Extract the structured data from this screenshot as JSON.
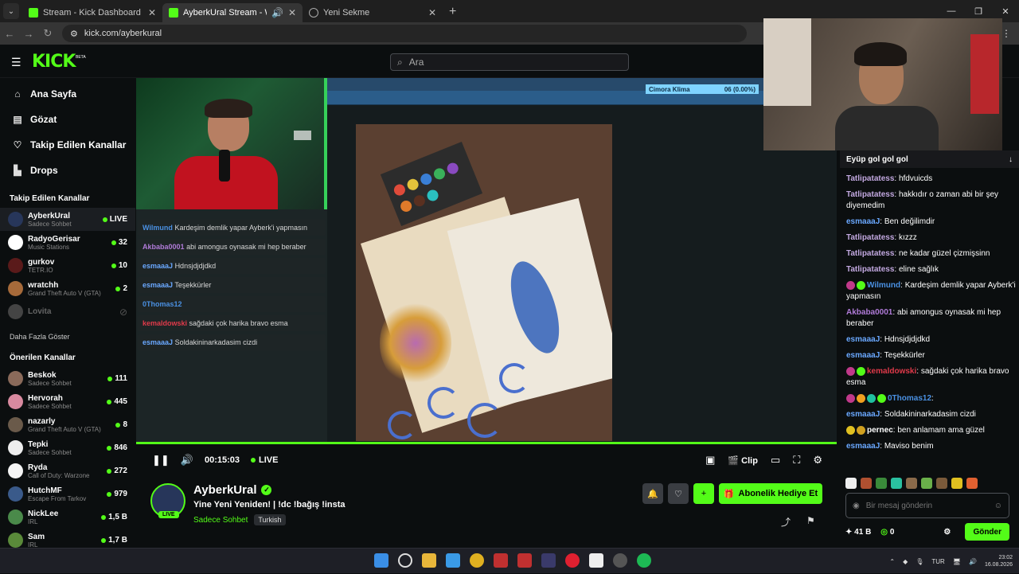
{
  "browser": {
    "tabs": [
      {
        "title": "Stream - Kick Dashboard",
        "active": false
      },
      {
        "title": "AyberkUral Stream - Watch",
        "active": true
      },
      {
        "title": "Yeni Sekme",
        "active": false
      }
    ],
    "url": "kick.com/ayberkural"
  },
  "header": {
    "logo": "KICK",
    "beta": "BETA",
    "search_placeholder": "Ara"
  },
  "sidebar": {
    "nav": [
      {
        "label": "Ana Sayfa",
        "icon": "home-icon",
        "glyph": "⌂"
      },
      {
        "label": "Gözat",
        "icon": "browse-icon",
        "glyph": "▤"
      },
      {
        "label": "Takip Edilen Kanallar",
        "icon": "heart-icon",
        "glyph": "♡"
      },
      {
        "label": "Drops",
        "icon": "drops-icon",
        "glyph": "▙"
      }
    ],
    "followed_title": "Takip Edilen Kanallar",
    "followed": [
      {
        "name": "AyberkUral",
        "category": "Sadece Sohbet",
        "viewers": "LIVE",
        "color": "#27365a"
      },
      {
        "name": "RadyoGerisar",
        "category": "Music Stations",
        "viewers": "32",
        "color": "#ffffff"
      },
      {
        "name": "gurkov",
        "category": "TETR.IO",
        "viewers": "10",
        "color": "#5a1a1a"
      },
      {
        "name": "wratchh",
        "category": "Grand Theft Auto V (GTA)",
        "viewers": "2",
        "color": "#a66a3a"
      },
      {
        "name": "Lovita",
        "category": "",
        "viewers": "",
        "color": "#444444"
      }
    ],
    "show_more": "Daha Fazla Göster",
    "recommended_title": "Önerilen Kanallar",
    "recommended": [
      {
        "name": "Beskok",
        "category": "Sadece Sohbet",
        "viewers": "111",
        "color": "#8a6a5a"
      },
      {
        "name": "Hervorah",
        "category": "Sadece Sohbet",
        "viewers": "445",
        "color": "#d98aa0"
      },
      {
        "name": "nazarly",
        "category": "Grand Theft Auto V (GTA)",
        "viewers": "8",
        "color": "#6a5a4a"
      },
      {
        "name": "Tepki",
        "category": "Sadece Sohbet",
        "viewers": "846",
        "color": "#eeeeee"
      },
      {
        "name": "Ryda",
        "category": "Call of Duty: Warzone",
        "viewers": "272",
        "color": "#f5f5f5"
      },
      {
        "name": "HutchMF",
        "category": "Escape From Tarkov",
        "viewers": "979",
        "color": "#3a5a8a"
      },
      {
        "name": "NickLee",
        "category": "IRL",
        "viewers": "1,5 B",
        "color": "#4a8a4a"
      },
      {
        "name": "Sam",
        "category": "IRL",
        "viewers": "1,7 B",
        "color": "#5a8a3a"
      }
    ]
  },
  "video": {
    "overlay_chat": [
      {
        "user": "Wilmund",
        "color": "#4a90e2",
        "text": "Kardeşim demlik yapar Ayberk'i yapmasın"
      },
      {
        "user": "Akbaba0001",
        "color": "#b07bd8",
        "text": "abi amongus oynasak mi hep beraber"
      },
      {
        "user": "esmaaaJ",
        "color": "#6aa8ff",
        "text": "Hdnsjdjdjdkd"
      },
      {
        "user": "esmaaaJ",
        "color": "#6aa8ff",
        "text": "Teşekkürler"
      },
      {
        "user": "0Thomas12",
        "color": "#4a90e2",
        "text": ""
      },
      {
        "user": "kemaldowski",
        "color": "#e03a4a",
        "text": "sağdaki çok harika bravo esma"
      },
      {
        "user": "esmaaaJ",
        "color": "#6aa8ff",
        "text": "Soldakininarkadasim cizdi"
      }
    ],
    "klima_label": "Cimora Klima",
    "klima_value": "06 (0.00%)",
    "progress": 1.0,
    "time": "00:15:03",
    "live": "LIVE",
    "clip": "Clip"
  },
  "stream": {
    "name": "AyberkUral",
    "title": "Yine Yeni Yeniden! | !dc !bağış !insta",
    "category": "Sadece Sohbet",
    "language": "Turkish",
    "live_badge": "LIVE",
    "subscribe_gift": "Abonelik Hediye Et"
  },
  "chat": {
    "pinned": "Eyüp gol gol gol",
    "messages": [
      {
        "user": "Tatlipatatess",
        "color": "#c2a8e0",
        "text": "hfdvuicds"
      },
      {
        "user": "Tatlipatatess",
        "color": "#c2a8e0",
        "text": "hakkıdır o zaman abi bir şey diyemedim"
      },
      {
        "user": "esmaaaJ",
        "color": "#6aa8ff",
        "text": "Ben değilimdir"
      },
      {
        "user": "Tatlipatatess",
        "color": "#c2a8e0",
        "text": "kızzz"
      },
      {
        "user": "Tatlipatatess",
        "color": "#c2a8e0",
        "text": "ne kadar güzel çizmişsinn"
      },
      {
        "user": "Tatlipatatess",
        "color": "#c2a8e0",
        "text": "eline sağlık"
      },
      {
        "user": "Wilmund",
        "color": "#4a90e2",
        "text": "Kardeşim demlik yapar Ayberk'i yapmasın",
        "badges": [
          "#c0398a",
          "#53fc18"
        ]
      },
      {
        "user": "Akbaba0001",
        "color": "#b07bd8",
        "text": "abi amongus oynasak mi hep beraber"
      },
      {
        "user": "esmaaaJ",
        "color": "#6aa8ff",
        "text": "Hdnsjdjdjdkd"
      },
      {
        "user": "esmaaaJ",
        "color": "#6aa8ff",
        "text": "Teşekkürler"
      },
      {
        "user": "kemaldowski",
        "color": "#e03a4a",
        "text": "sağdaki çok harika bravo esma",
        "badges": [
          "#c0398a",
          "#53fc18"
        ]
      },
      {
        "user": "0Thomas12",
        "color": "#4a90e2",
        "text": "",
        "badges": [
          "#c0398a",
          "#f0a020",
          "#20c0a0",
          "#53fc18"
        ]
      },
      {
        "user": "esmaaaJ",
        "color": "#6aa8ff",
        "text": "Soldakininarkadasim cizdi"
      },
      {
        "user": "pernec",
        "color": "#ffffff",
        "text": "ben anlamam ama güzel",
        "badges": [
          "#e0c020",
          "#d0a020"
        ]
      },
      {
        "user": "esmaaaJ",
        "color": "#6aa8ff",
        "text": "Maviso benim"
      }
    ],
    "input_placeholder": "Bir mesaj gönderin",
    "points": "41 B",
    "kicks": "0",
    "send": "Gönder"
  },
  "taskbar": {
    "lang": "TUR",
    "time": "23:02",
    "date": "16.08.2026"
  }
}
